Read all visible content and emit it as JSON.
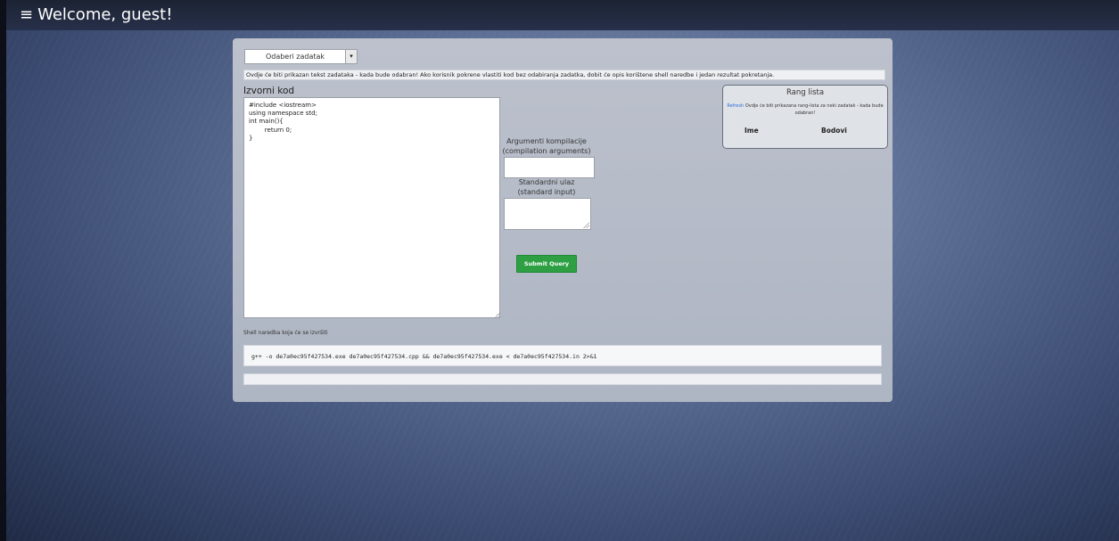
{
  "header": {
    "menu_icon": "≡",
    "title": "Welcome, guest!"
  },
  "task_select": {
    "selected": "Odaberi zadatak",
    "arrow_icon": "▾"
  },
  "task_text": "Ovdje će biti prikazan tekst zadataka - kada bude odabran! Ako korisnik pokrene vlastiti kod bez odabiranja zadatka, dobit će opis korištene shell naredbe i jedan rezultat pokretanja.",
  "code": {
    "label": "Izvorni kod",
    "content": "#include <iostream>\nusing namespace std;\nint main(){\n        return 0;\n}"
  },
  "compile_args": {
    "label_line1": "Argumenti kompilacije",
    "label_line2": "(compilation arguments)",
    "value": ""
  },
  "stdin": {
    "label_line1": "Standardni ulaz",
    "label_line2": "(standard input)",
    "value": ""
  },
  "submit_label": "Submit Query",
  "rank": {
    "title": "Rang lista",
    "refresh_label": "Refresh",
    "message": "Ovdje će biti prikazana rang-lista za neki zadatak - kada bude odabran!",
    "col_name": "Ime",
    "col_points": "Bodovi"
  },
  "shell": {
    "label": "Shell naredba koja će se izvršiti",
    "command": "g++  -o de7a0ec95f427534.exe de7a0ec95f427534.cpp && de7a0ec95f427534.exe < de7a0ec95f427534.in 2>&1"
  },
  "result": ""
}
